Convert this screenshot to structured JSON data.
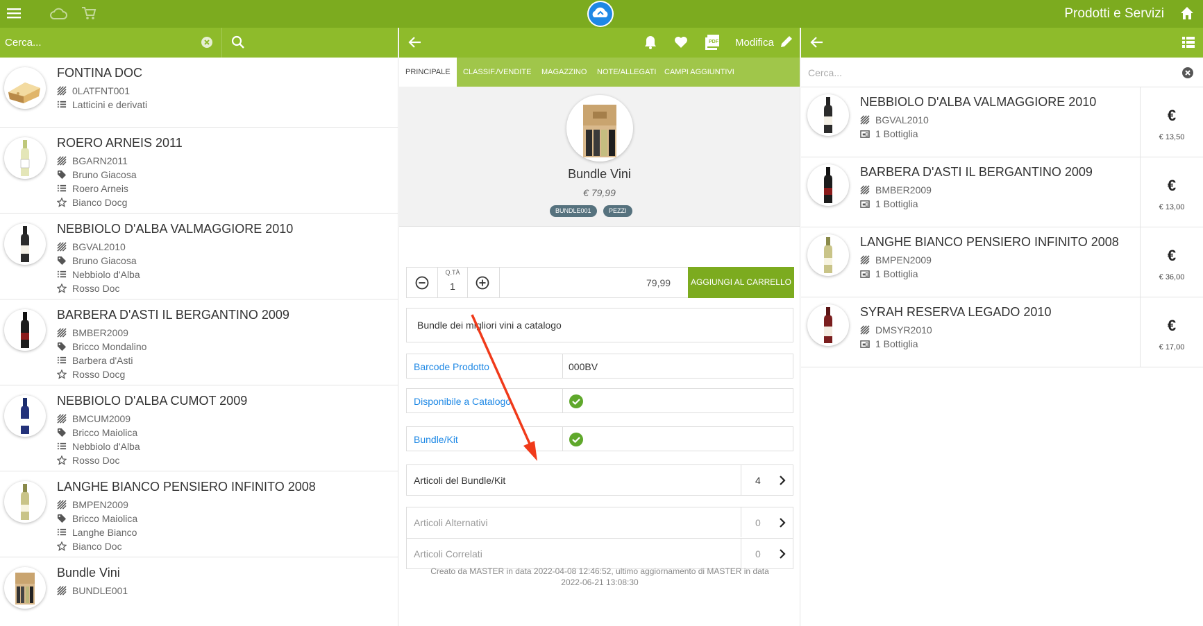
{
  "app": {
    "title": "Prodotti e Servizi"
  },
  "left": {
    "search_placeholder": "Cerca...",
    "items": [
      {
        "name": "FONTINA DOC",
        "code": "0LATFNT001",
        "category": "Latticini e derivati",
        "thumb": "cheese"
      },
      {
        "name": "ROERO ARNEIS 2011",
        "code": "BGARN2011",
        "producer": "Bruno Giacosa",
        "type": "Roero Arneis",
        "class": "Bianco Docg",
        "thumb": "white-wine"
      },
      {
        "name": "NEBBIOLO D'ALBA VALMAGGIORE 2010",
        "code": "BGVAL2010",
        "producer": "Bruno Giacosa",
        "type": "Nebbiolo d'Alba",
        "class": "Rosso Doc",
        "thumb": "red-wine"
      },
      {
        "name": "BARBERA D'ASTI IL BERGANTINO 2009",
        "code": "BMBER2009",
        "producer": "Bricco Mondalino",
        "type": "Barbera d'Asti",
        "class": "Rosso Docg",
        "thumb": "dark-wine"
      },
      {
        "name": "NEBBIOLO D'ALBA CUMOT 2009",
        "code": "BMCUM2009",
        "producer": "Bricco Maiolica",
        "type": "Nebbiolo d'Alba",
        "class": "Rosso Doc",
        "thumb": "blue-wine"
      },
      {
        "name": "LANGHE BIANCO PENSIERO INFINITO 2008",
        "code": "BMPEN2009",
        "producer": "Bricco Maiolica",
        "type": "Langhe Bianco",
        "class": "Bianco Doc",
        "thumb": "white-wine"
      },
      {
        "name": "Bundle Vini",
        "code": "BUNDLE001",
        "thumb": "box"
      }
    ]
  },
  "detail": {
    "toolbar": {
      "modify_label": "Modifica"
    },
    "tabs": [
      "PRINCIPALE",
      "CLASSIF./VENDITE",
      "MAGAZZINO",
      "NOTE/ALLEGATI",
      "CAMPI AGGIUNTIVI"
    ],
    "product_name": "Bundle Vini",
    "price": "€ 79,99",
    "chips": [
      "BUNDLE001",
      "PEZZI"
    ],
    "qty_label": "Q.TÀ",
    "qty": "1",
    "total": "79,99",
    "add_to_cart": "AGGIUNGI AL CARRELLO",
    "description": "Bundle dei migliori vini a catalogo",
    "props": [
      {
        "key": "Barcode Prodotto",
        "value": "000BV"
      },
      {
        "key": "Disponibile a Catalogo",
        "checked": true
      },
      {
        "key": "Bundle/Kit",
        "checked": true
      }
    ],
    "links": [
      {
        "label": "Articoli del Bundle/Kit",
        "count": "4",
        "enabled": true
      },
      {
        "label": "Articoli Alternativi",
        "count": "0",
        "enabled": false
      },
      {
        "label": "Articoli Correlati",
        "count": "0",
        "enabled": false
      }
    ],
    "footer": "Creato da MASTER in data 2022-04-08 12:46:52, ultimo aggiornamento di MASTER in data 2022-06-21 13:08:30"
  },
  "bundle": {
    "search_placeholder": "Cerca...",
    "items": [
      {
        "name": "NEBBIOLO D'ALBA VALMAGGIORE 2010",
        "code": "BGVAL2010",
        "qty": "1 Bottiglia",
        "currency": "€",
        "price": "€ 13,50",
        "thumb": "red-wine"
      },
      {
        "name": "BARBERA D'ASTI IL BERGANTINO 2009",
        "code": "BMBER2009",
        "qty": "1 Bottiglia",
        "currency": "€",
        "price": "€ 13,00",
        "thumb": "dark-wine"
      },
      {
        "name": "LANGHE BIANCO PENSIERO INFINITO 2008",
        "code": "BMPEN2009",
        "qty": "1 Bottiglia",
        "currency": "€",
        "price": "€ 36,00",
        "thumb": "white-wine"
      },
      {
        "name": "SYRAH RESERVA LEGADO 2010",
        "code": "DMSYR2010",
        "qty": "1 Bottiglia",
        "currency": "€",
        "price": "€ 17,00",
        "thumb": "rose-wine"
      }
    ]
  },
  "colors": {
    "brand": "#7cab1f",
    "bar": "#8ebb2b",
    "tabs": "#a0c64a",
    "link": "#1e88e5",
    "check": "#5fa82b",
    "annotation": "#f03a1a"
  }
}
